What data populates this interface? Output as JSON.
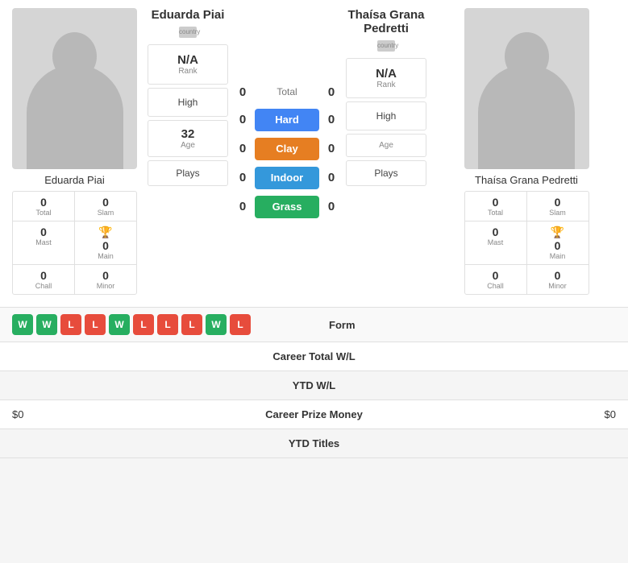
{
  "player1": {
    "name": "Eduarda Piai",
    "name_label": "Eduarda Piai",
    "country": "country",
    "rank": "N/A",
    "rank_label": "Rank",
    "high": "High",
    "age": "32",
    "age_label": "Age",
    "plays": "Plays",
    "total": "0",
    "slam": "0",
    "slam_label": "Slam",
    "total_label": "Total",
    "mast": "0",
    "mast_label": "Mast",
    "main": "0",
    "main_label": "Main",
    "chall": "0",
    "chall_label": "Chall",
    "minor": "0",
    "minor_label": "Minor"
  },
  "player2": {
    "name": "Thaísa Grana Pedretti",
    "name_label": "Thaísa Grana Pedretti",
    "country": "country",
    "rank": "N/A",
    "rank_label": "Rank",
    "high": "High",
    "age": "",
    "age_label": "Age",
    "plays": "Plays",
    "total": "0",
    "slam": "0",
    "slam_label": "Slam",
    "total_label": "Total",
    "mast": "0",
    "mast_label": "Mast",
    "main": "0",
    "main_label": "Main",
    "chall": "0",
    "chall_label": "Chall",
    "minor": "0",
    "minor_label": "Minor"
  },
  "surfaces": {
    "total_label": "Total",
    "p1_total": "0",
    "p2_total": "0",
    "hard_label": "Hard",
    "p1_hard": "0",
    "p2_hard": "0",
    "clay_label": "Clay",
    "p1_clay": "0",
    "p2_clay": "0",
    "indoor_label": "Indoor",
    "p1_indoor": "0",
    "p2_indoor": "0",
    "grass_label": "Grass",
    "p1_grass": "0",
    "p2_grass": "0"
  },
  "form": {
    "label": "Form",
    "p1_form": [
      "W",
      "W",
      "L",
      "L",
      "W",
      "L",
      "L",
      "L",
      "W",
      "L"
    ],
    "p2_form": []
  },
  "bottom_rows": [
    {
      "left": "",
      "center": "Career Total W/L",
      "right": ""
    },
    {
      "left": "",
      "center": "YTD W/L",
      "right": ""
    },
    {
      "left": "$0",
      "center": "Career Prize Money",
      "right": "$0"
    },
    {
      "left": "",
      "center": "YTD Titles",
      "right": ""
    }
  ]
}
